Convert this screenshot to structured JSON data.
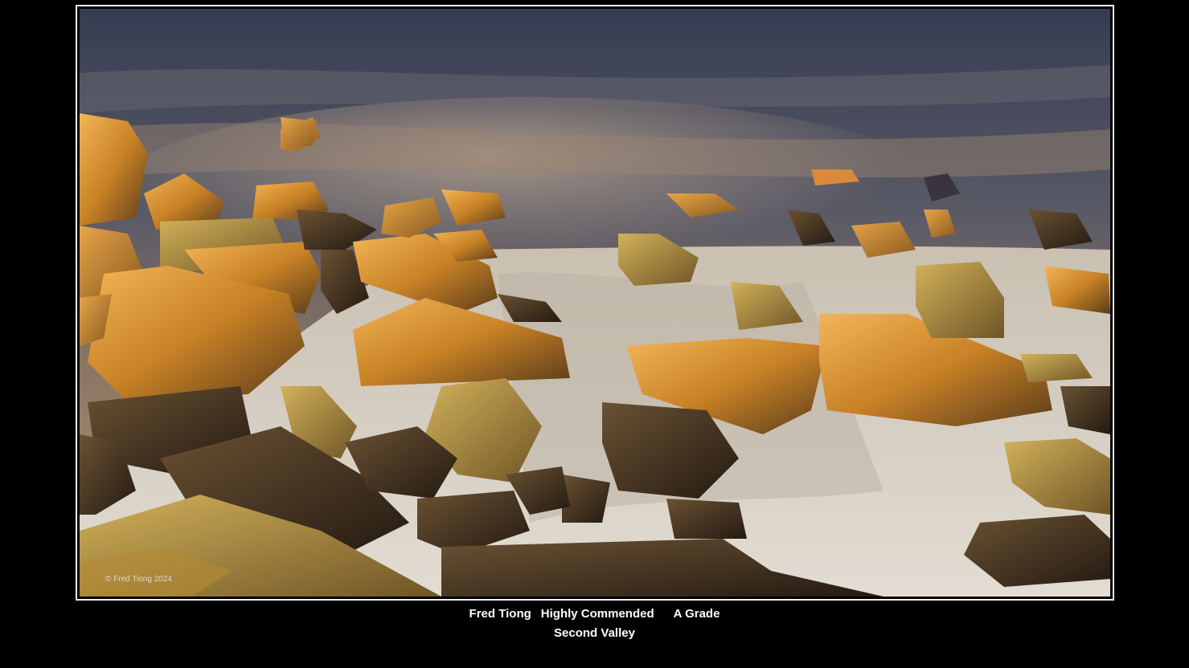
{
  "photo": {
    "subject": "long-exposure seascape: golden-lit rocks on a sandy shore with smooth misty water and a dusky sky",
    "watermark": "© Fred Tiong 2024"
  },
  "caption": {
    "author": "Fred Tiong",
    "award": "Highly Commended",
    "grade": "A Grade",
    "title": "Second Valley"
  },
  "colors": {
    "background": "#000000",
    "frame": "#f2f2f2",
    "caption_text": "#ffffff",
    "rock_highlight": "#e39a3a",
    "rock_shadow": "#3a2c1e",
    "sand": "#d9d2c5",
    "sky": "#4a5066"
  }
}
